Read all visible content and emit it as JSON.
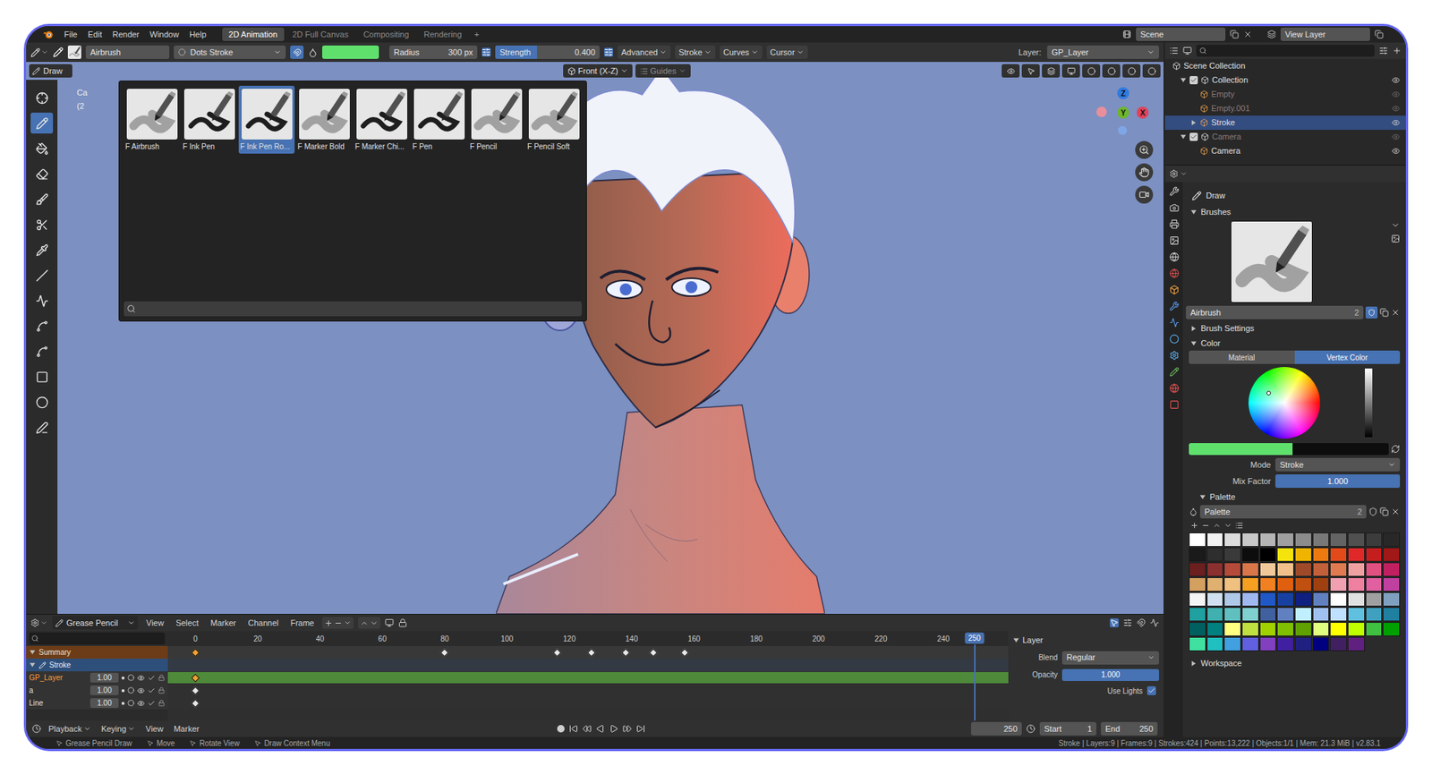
{
  "menu": [
    "File",
    "Edit",
    "Render",
    "Window",
    "Help"
  ],
  "workspaces": [
    {
      "label": "2D Animation",
      "selected": true
    },
    {
      "label": "2D Full Canvas",
      "selected": false
    },
    {
      "label": "Compositing",
      "selected": false
    },
    {
      "label": "Rendering",
      "selected": false
    }
  ],
  "workspace_add": "+",
  "scene": "Scene",
  "view_layer": "View Layer",
  "tool_header": {
    "brush": "Airbrush",
    "stroke_mode": "Dots Stroke",
    "color": "#5fe06c",
    "radius_label": "Radius",
    "radius": "300 px",
    "strength_label": "Strength",
    "strength": "0.400",
    "strength_level": 0.4,
    "menus": [
      "Advanced",
      "Stroke",
      "Curves",
      "Cursor"
    ],
    "layer_label": "Layer:",
    "layer": "GP_Layer"
  },
  "mode": "Draw",
  "brush_popup": {
    "brushes": [
      {
        "label": "F Airbrush",
        "kind": "soft",
        "selected": false
      },
      {
        "label": "F Ink Pen",
        "kind": "hard",
        "selected": false
      },
      {
        "label": "F Ink Pen Ro...",
        "kind": "hard",
        "selected": true
      },
      {
        "label": "F Marker Bold",
        "kind": "soft",
        "selected": false
      },
      {
        "label": "F Marker Chi...",
        "kind": "hard",
        "selected": false
      },
      {
        "label": "F Pen",
        "kind": "hard",
        "selected": false
      },
      {
        "label": "F Pencil",
        "kind": "soft",
        "selected": false
      },
      {
        "label": "F Pencil Soft",
        "kind": "soft",
        "selected": false
      }
    ]
  },
  "viewport": {
    "view": "Front (X-Z)",
    "guides": "Guides",
    "view_name": "Ca",
    "frame_label": "(2",
    "gizmo_axes": [
      {
        "label": "Z",
        "color": "#2f7be0"
      },
      {
        "label": "Y",
        "color": "#6eb52f"
      },
      {
        "label": "X",
        "color": "#e0435a"
      }
    ]
  },
  "outliner": {
    "label": "Scene Collection",
    "children": [
      {
        "label": "Collection",
        "expanded": true,
        "checked": true,
        "selected": false,
        "disabled": false,
        "children": [
          {
            "label": "Empty",
            "selected": false,
            "disabled": true
          },
          {
            "label": "Empty.001",
            "selected": false,
            "disabled": true
          },
          {
            "label": "Stroke",
            "expanded": false,
            "selected": true,
            "disabled": false
          }
        ]
      },
      {
        "label": "Camera",
        "expanded": true,
        "checked": true,
        "selected": false,
        "disabled": true,
        "children": [
          {
            "label": "Camera",
            "selected": false,
            "disabled": false
          }
        ]
      }
    ]
  },
  "properties": {
    "tool": "Draw",
    "brushes": {
      "label": "Brushes",
      "expanded": true
    },
    "brush_name": "Airbrush",
    "brush_users": "2",
    "brush_settings": {
      "label": "Brush Settings",
      "expanded": false
    },
    "color_section": {
      "label": "Color",
      "expanded": true
    },
    "color_tabs": [
      {
        "label": "Material",
        "selected": false
      },
      {
        "label": "Vertex Color",
        "selected": true
      }
    ],
    "color": "#5fe06c",
    "secondary_color": "#0d0d0d",
    "mode_label": "Mode",
    "mode": "Stroke",
    "mix_label": "Mix Factor",
    "mix": "1.000",
    "mix_level": 1,
    "palette_section": {
      "label": "Palette",
      "expanded": true
    },
    "palette_name": "Palette",
    "palette_users": "2",
    "swatches": [
      "#ffffff",
      "#f2f2f2",
      "#dcdcdc",
      "#c8c8c8",
      "#b4b4b4",
      "#a0a0a0",
      "#8c8c8c",
      "#787878",
      "#646464",
      "#505050",
      "#3c3c3c",
      "#282828",
      "#1a1a1a",
      "#2e2e2e",
      "#3a3a3a",
      "#0d0d0d",
      "#000000",
      "#f5e40c",
      "#f0b400",
      "#ec7a10",
      "#e34a1a",
      "#e02828",
      "#c41e1e",
      "#a01818",
      "#6b1f1f",
      "#8c2f2f",
      "#b54a3a",
      "#d9764a",
      "#f0c89a",
      "#f2c08a",
      "#9e4a2a",
      "#c2603a",
      "#e07a50",
      "#f0a0a0",
      "#e05080",
      "#c02060",
      "#d4a060",
      "#e0b070",
      "#f0c080",
      "#f5a020",
      "#f08020",
      "#e06010",
      "#c05010",
      "#a04010",
      "#f0a0b0",
      "#f080a0",
      "#e060a0",
      "#c040a0",
      "#f4f4f4",
      "#d0e0f0",
      "#b0c8e8",
      "#a0b8f0",
      "#2058c8",
      "#1840a0",
      "#102080",
      "#6080c0",
      "#ffffff",
      "#e0e0e0",
      "#a0a0a0",
      "#80a0c0",
      "#20a0a0",
      "#40b0b0",
      "#60c0c0",
      "#80d0d0",
      "#4060a0",
      "#6080c0",
      "#c0f0ff",
      "#a0c0f0",
      "#c0e0ff",
      "#60c0e0",
      "#40a0c0",
      "#2080a0",
      "#006060",
      "#008080",
      "#ffff80",
      "#c0e040",
      "#a0d000",
      "#80c000",
      "#60a000",
      "#e0ff80",
      "#ffff00",
      "#c0ff00",
      "#40c040",
      "#00a000",
      "#40e0a0",
      "#20c0c0",
      "#40a0e0",
      "#6060e0",
      "#8040c0",
      "#4020a0",
      "#202080",
      "#000080",
      "#402060",
      "#602080"
    ],
    "workspace_section": {
      "label": "Workspace",
      "expanded": false
    }
  },
  "dopesheet": {
    "editor": "Grease Pencil",
    "menus": [
      "View",
      "Select",
      "Marker",
      "Channel",
      "Frame"
    ],
    "ticks": [
      "0",
      "20",
      "40",
      "60",
      "80",
      "100",
      "120",
      "140",
      "160",
      "180",
      "200",
      "220",
      "240"
    ],
    "current_frame": "250",
    "channels": [
      {
        "label": "Summary",
        "kind": "summary",
        "selected": false,
        "keys": [
          {
            "frame": 0,
            "selected": true
          },
          {
            "frame": 80,
            "selected": false
          },
          {
            "frame": 116,
            "selected": false
          },
          {
            "frame": 127,
            "selected": false
          },
          {
            "frame": 138,
            "selected": false
          },
          {
            "frame": 147,
            "selected": false
          },
          {
            "frame": 157,
            "selected": false
          }
        ]
      },
      {
        "label": "Stroke",
        "kind": "object",
        "selected": false,
        "keys": []
      },
      {
        "label": "GP_Layer",
        "kind": "layer",
        "value": "1.00",
        "selected": true,
        "keys": [
          {
            "frame": 0,
            "selected": true
          }
        ]
      },
      {
        "label": "a",
        "kind": "layer",
        "value": "1.00",
        "selected": false,
        "keys": [
          {
            "frame": 0,
            "selected": false
          }
        ]
      },
      {
        "label": "Line",
        "kind": "layer",
        "value": "1.00",
        "selected": false,
        "keys": [
          {
            "frame": 0,
            "selected": false
          }
        ]
      }
    ],
    "layer_panel": {
      "title": "Layer",
      "blend_label": "Blend",
      "blend": "Regular",
      "opacity_label": "Opacity",
      "opacity": "1.000",
      "opacity_level": 1,
      "use_lights_label": "Use Lights",
      "use_lights": true
    }
  },
  "playback": {
    "menus": [
      "Playback",
      "Keying",
      "View",
      "Marker"
    ],
    "frame": "250",
    "start_label": "Start",
    "start": "1",
    "end_label": "End",
    "end": "250"
  },
  "status": {
    "items": [
      "Grease Pencil Draw",
      "Move",
      "Rotate View",
      "Draw Context Menu"
    ],
    "stats": "Stroke | Layers:9 | Frames:9 | Strokes:424 | Points:13,222 | Objects:1/1 | Mem: 21.3 MiB | v2.83.1"
  }
}
